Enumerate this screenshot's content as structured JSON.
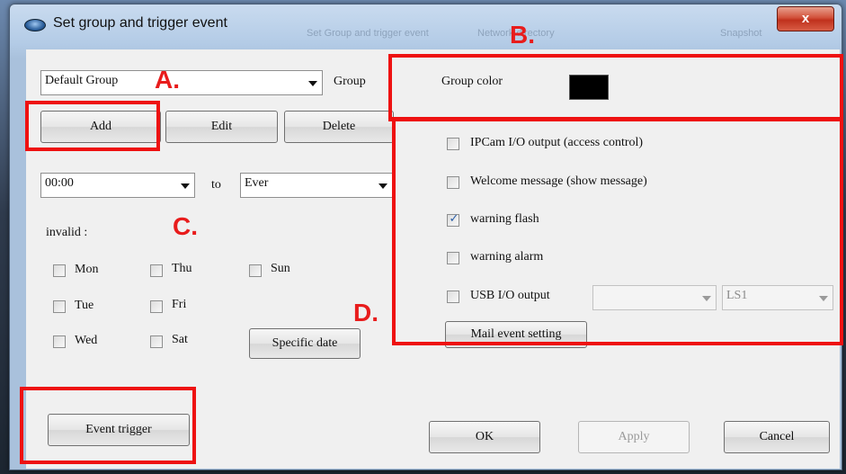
{
  "window": {
    "title": "Set group and trigger event",
    "close_glyph": "x",
    "background_titles": [
      "Set Group and trigger event",
      "Network directory",
      "Snapshot"
    ]
  },
  "group": {
    "selected": "Default Group",
    "label": "Group",
    "add_label": "Add",
    "edit_label": "Edit",
    "delete_label": "Delete",
    "color_label": "Group color",
    "color_value": "#000000"
  },
  "time": {
    "from_value": "00:00",
    "to_label": "to",
    "to_value": "Ever"
  },
  "invalid": {
    "label": "invalid :",
    "days": [
      {
        "label": "Mon",
        "checked": false
      },
      {
        "label": "Tue",
        "checked": false
      },
      {
        "label": "Wed",
        "checked": false
      },
      {
        "label": "Thu",
        "checked": false
      },
      {
        "label": "Fri",
        "checked": false
      },
      {
        "label": "Sat",
        "checked": false
      },
      {
        "label": "Sun",
        "checked": false
      }
    ],
    "specific_date_label": "Specific date"
  },
  "events": {
    "ipcam_io_label": "IPCam I/O output (access control)",
    "welcome_label": "Welcome message (show message)",
    "warning_flash_label": "warning flash",
    "warning_alarm_label": "warning alarm",
    "usb_io_label": "USB I/O output",
    "usb_port_value": "",
    "usb_level_value": "LS1",
    "mail_label": "Mail event setting",
    "checked": {
      "ipcam_io": false,
      "welcome": false,
      "warning_flash": true,
      "warning_alarm": false,
      "usb_io": false
    }
  },
  "footer": {
    "event_trigger_label": "Event trigger",
    "ok_label": "OK",
    "apply_label": "Apply",
    "cancel_label": "Cancel"
  },
  "annotations": {
    "a": "A.",
    "b": "B.",
    "c": "C.",
    "d": "D."
  },
  "colors": {
    "annotation": "#e81c1c",
    "checkmark": "#2a5ea8"
  },
  "icons": {
    "app": "app-icon",
    "close": "close-icon",
    "dropdown": "chevron-down-icon",
    "check": "checkmark-icon"
  }
}
